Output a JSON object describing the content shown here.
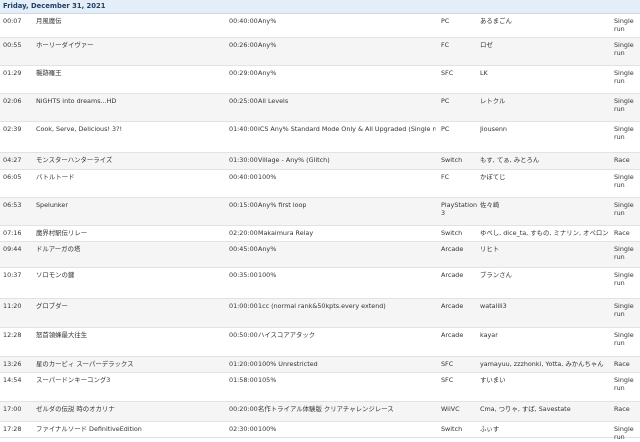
{
  "schedule": {
    "date_header": "Friday, December 31, 2021",
    "rows": [
      {
        "time": "00:07",
        "title": "月風魔伝",
        "estimate": "00:40:00",
        "category": "Any%",
        "platform": "PC",
        "runners": "あるまごん",
        "type": "Single run"
      },
      {
        "time": "00:55",
        "title": "ホーリーダイヴァー",
        "estimate": "00:26:00",
        "category": "Any%",
        "platform": "FC",
        "runners": "ロゼ",
        "type": "Single run"
      },
      {
        "time": "01:29",
        "title": "襲跡羅王",
        "estimate": "00:29:00",
        "category": "Any%",
        "platform": "SFC",
        "runners": "LK",
        "type": "Single run"
      },
      {
        "time": "02:06",
        "title": "NiGHTS into dreams...HD",
        "estimate": "00:25:00",
        "category": "All Levels",
        "platform": "PC",
        "runners": "レトクル",
        "type": "Single run"
      },
      {
        "time": "02:39",
        "title": "Cook, Serve, Delicious! 3?!",
        "estimate": "01:40:00",
        "category": "ICS Any% Standard Mode Only & All Upgraded (Single run)",
        "platform": "PC",
        "runners": "Jiousenn",
        "type": "Single run"
      },
      {
        "time": "04:27",
        "title": "モンスターハンターライズ",
        "estimate": "01:30:00",
        "category": "Village - Any% (Glitch)",
        "platform": "Switch",
        "runners": "もす, てぁ, みとろん",
        "type": "Race"
      },
      {
        "time": "06:05",
        "title": "バトルトード",
        "estimate": "00:40:00",
        "category": "100%",
        "platform": "FC",
        "runners": "かぼてじ",
        "type": "Single run"
      },
      {
        "time": "06:53",
        "title": "Spelunker",
        "estimate": "00:15:00",
        "category": "Any% first loop",
        "platform": "PlayStation 3",
        "runners": "佐々崎",
        "type": "Single run"
      },
      {
        "time": "07:16",
        "title": "魔界村駅伝リレー",
        "estimate": "02:20:00",
        "category": "Makaimura Relay",
        "platform": "Switch",
        "runners": "ゆぺし, dice_ta, すもの, ミナリン, オペロン",
        "type": "Race"
      },
      {
        "time": "09:44",
        "title": "ドルアーガの塔",
        "estimate": "00:45:00",
        "category": "Any%",
        "platform": "Arcade",
        "runners": "リヒト",
        "type": "Single run"
      },
      {
        "time": "10:37",
        "title": "ソロモンの鍵",
        "estimate": "00:35:00",
        "category": "100%",
        "platform": "Arcade",
        "runners": "ブランさん",
        "type": "Single run"
      },
      {
        "time": "11:20",
        "title": "グロブダー",
        "estimate": "01:00:00",
        "category": "1cc (normal rank&50kpts.every extend)",
        "platform": "Arcade",
        "runners": "watalili3",
        "type": "Single run"
      },
      {
        "time": "12:28",
        "title": "怒首領蜂最大往生",
        "estimate": "00:50:00",
        "category": "ハイスコアアタック",
        "platform": "Arcade",
        "runners": "kayar",
        "type": "Single run"
      },
      {
        "time": "13:26",
        "title": "星のカービィ スーパーデラックス",
        "estimate": "01:20:00",
        "category": "100% Unrestricted",
        "platform": "SFC",
        "runners": "yamayuu, zzzhonki, Yotta, みかんちゃん",
        "type": "Race"
      },
      {
        "time": "14:54",
        "title": "スーパードンキーコング3",
        "estimate": "01:58:00",
        "category": "105%",
        "platform": "SFC",
        "runners": "すいまい",
        "type": "Single run"
      },
      {
        "time": "17:00",
        "title": "ゼルダの伝説 時のオカリナ",
        "estimate": "00:20:00",
        "category": "名作トライアル体験版 クリアチャレンジレース",
        "platform": "WiiVC",
        "runners": "Cma, つりゃ, すば, Savestate",
        "type": "Race"
      },
      {
        "time": "17:28",
        "title": "ファイナルソード DefinitiveEdition",
        "estimate": "02:30:00",
        "category": "100%",
        "platform": "Switch",
        "runners": "ふぃす",
        "type": "Single run"
      }
    ]
  }
}
